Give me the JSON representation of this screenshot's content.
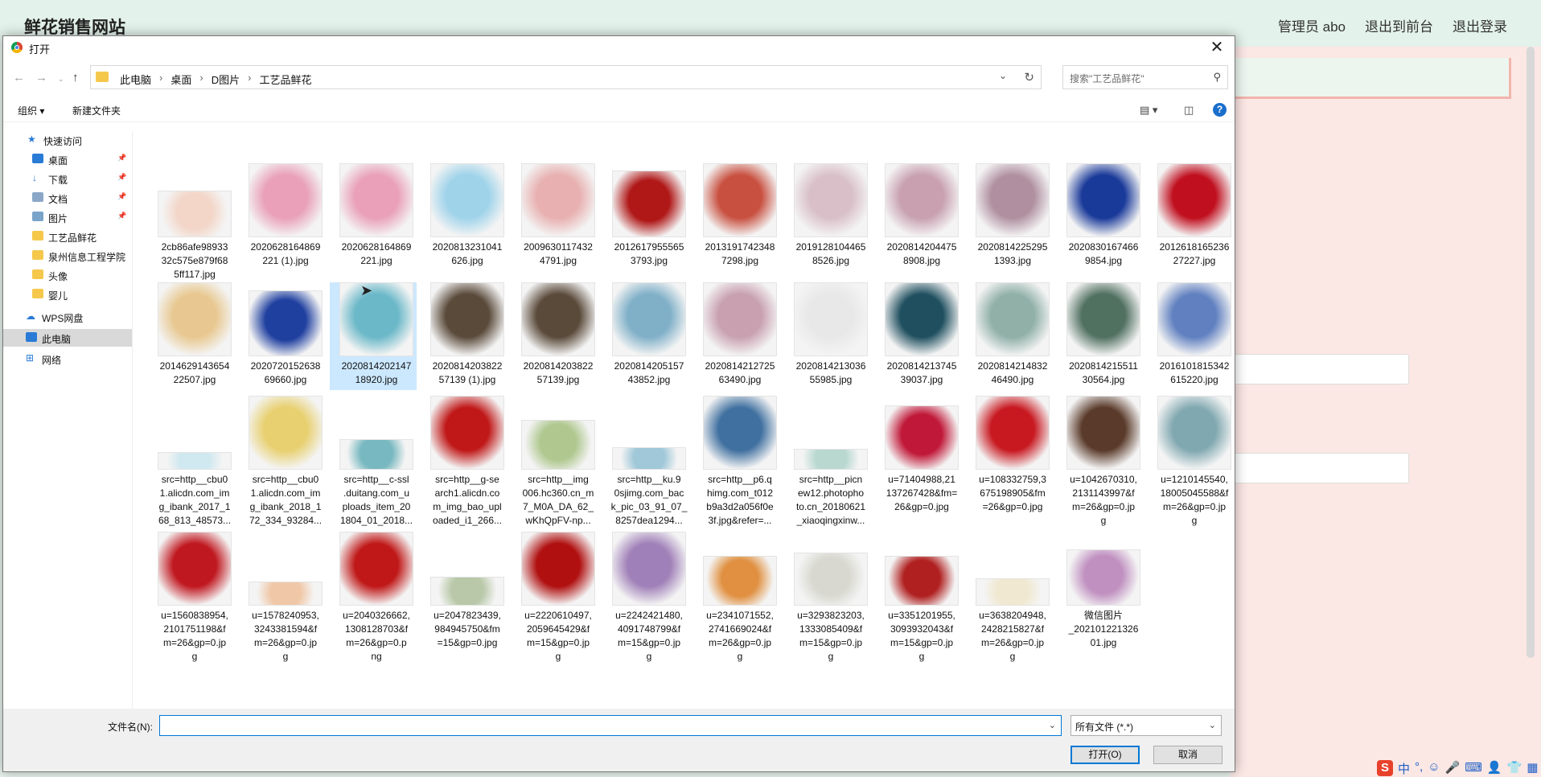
{
  "website": {
    "title": "鲜花销售网站",
    "nav": [
      "管理员 abo",
      "退出到前台",
      "退出登录"
    ]
  },
  "dialog": {
    "title": "打开",
    "breadcrumbs": [
      "此电脑",
      "桌面",
      "D图片",
      "工艺品鲜花"
    ],
    "search_placeholder": "搜索\"工艺品鲜花\"",
    "toolbar": {
      "organize": "组织 ▾",
      "new_folder": "新建文件夹"
    },
    "sidebar": {
      "items": [
        {
          "label": "快速访问",
          "icon": "star-icon"
        },
        {
          "label": "桌面",
          "icon": "desktop-icon"
        },
        {
          "label": "下载",
          "icon": "download-icon"
        },
        {
          "label": "文档",
          "icon": "document-icon"
        },
        {
          "label": "图片",
          "icon": "picture-icon"
        },
        {
          "label": "工艺品鲜花",
          "icon": "folder-icon"
        },
        {
          "label": "泉州信息工程学院",
          "icon": "folder-icon"
        },
        {
          "label": "头像",
          "icon": "folder-icon"
        },
        {
          "label": "婴儿",
          "icon": "folder-icon"
        },
        {
          "label": "WPS网盘",
          "icon": "cloud-icon"
        },
        {
          "label": "此电脑",
          "icon": "computer-icon"
        },
        {
          "label": "网络",
          "icon": "network-icon"
        }
      ],
      "selected": "此电脑"
    },
    "files": [
      [
        "2cb86afe98933",
        "32c575e879f68",
        "5ff117.jpg"
      ],
      [
        "2020628164869",
        "221 (1).jpg"
      ],
      [
        "2020628164869",
        "221.jpg"
      ],
      [
        "2020813231041",
        "626.jpg"
      ],
      [
        "2009630117432",
        "4791.jpg"
      ],
      [
        "2012617955565",
        "3793.jpg"
      ],
      [
        "2013191742348",
        "7298.jpg"
      ],
      [
        "2019128104465",
        "8526.jpg"
      ],
      [
        "2020814204475",
        "8908.jpg"
      ],
      [
        "2020814225295",
        "1393.jpg"
      ],
      [
        "2020830167466",
        "9854.jpg"
      ],
      [
        "2012618165236",
        "27227.jpg"
      ],
      [
        "2014629143654",
        "22507.jpg"
      ],
      [
        "2020720152638",
        "69660.jpg"
      ],
      [
        "2020814202147",
        "18920.jpg"
      ],
      [
        "2020814203822",
        "57139 (1).jpg"
      ],
      [
        "2020814203822",
        "57139.jpg"
      ],
      [
        "2020814205157",
        "43852.jpg"
      ],
      [
        "2020814212725",
        "63490.jpg"
      ],
      [
        "2020814213036",
        "55985.jpg"
      ],
      [
        "2020814213745",
        "39037.jpg"
      ],
      [
        "2020814214832",
        "46490.jpg"
      ],
      [
        "2020814215511",
        "30564.jpg"
      ],
      [
        "2016101815342",
        "615220.jpg"
      ],
      [
        "src=http__cbu0",
        "1.alicdn.com_im",
        "g_ibank_2017_1",
        "68_813_48573..."
      ],
      [
        "src=http__cbu0",
        "1.alicdn.com_im",
        "g_ibank_2018_1",
        "72_334_93284..."
      ],
      [
        "src=http__c-ssl",
        ".duitang.com_u",
        "ploads_item_20",
        "1804_01_2018..."
      ],
      [
        "src=http__g-se",
        "arch1.alicdn.co",
        "m_img_bao_upl",
        "oaded_i1_266..."
      ],
      [
        "src=http__img",
        "006.hc360.cn_m",
        "7_M0A_DA_62_",
        "wKhQpFV-np..."
      ],
      [
        "src=http__ku.9",
        "0sjimg.com_bac",
        "k_pic_03_91_07_",
        "8257dea1294..."
      ],
      [
        "src=http__p6.q",
        "himg.com_t012",
        "b9a3d2a056f0e",
        "3f.jpg&refer=..."
      ],
      [
        "src=http__picn",
        "ew12.photopho",
        "to.cn_20180621",
        "_xiaoqingxinw..."
      ],
      [
        "u=71404988,21",
        "137267428&fm=",
        "26&gp=0.jpg"
      ],
      [
        "u=108332759,3",
        "675198905&fm",
        "=26&gp=0.jpg"
      ],
      [
        "u=1042670310,",
        "2131143997&f",
        "m=26&gp=0.jp",
        "g"
      ],
      [
        "u=1210145540,",
        "18005045588&f",
        "m=26&gp=0.jp",
        "g"
      ],
      [
        "u=1560838954,",
        "2101751198&f",
        "m=26&gp=0.jp",
        "g"
      ],
      [
        "u=1578240953,",
        "3243381594&f",
        "m=26&gp=0.jp",
        "g"
      ],
      [
        "u=2040326662,",
        "1308128703&f",
        "m=26&gp=0.p",
        "ng"
      ],
      [
        "u=2047823439,",
        "984945750&fm",
        "=15&gp=0.jpg"
      ],
      [
        "u=2220610497,",
        "2059645429&f",
        "m=15&gp=0.jp",
        "g"
      ],
      [
        "u=2242421480,",
        "4091748799&f",
        "m=15&gp=0.jp",
        "g"
      ],
      [
        "u=2341071552,",
        "2741669024&f",
        "m=26&gp=0.jp",
        "g"
      ],
      [
        "u=3293823203,",
        "1333085409&f",
        "m=15&gp=0.jp",
        "g"
      ],
      [
        "u=3351201955,",
        "3093932043&f",
        "m=15&gp=0.jp",
        "g"
      ],
      [
        "u=3638204948,",
        "2428215827&f",
        "m=26&gp=0.jp",
        "g"
      ],
      [
        "微信图片",
        "_202101221326",
        "01.jpg"
      ]
    ],
    "selected_index": 14,
    "filename_label": "文件名(N):",
    "filename_value": "",
    "filter": "所有文件 (*.*)",
    "open_button": "打开(O)",
    "cancel_button": "取消"
  },
  "ime": [
    "S",
    "中",
    "°,",
    "☺",
    "🎤",
    "⌨",
    "👤",
    "👕",
    "▦"
  ]
}
